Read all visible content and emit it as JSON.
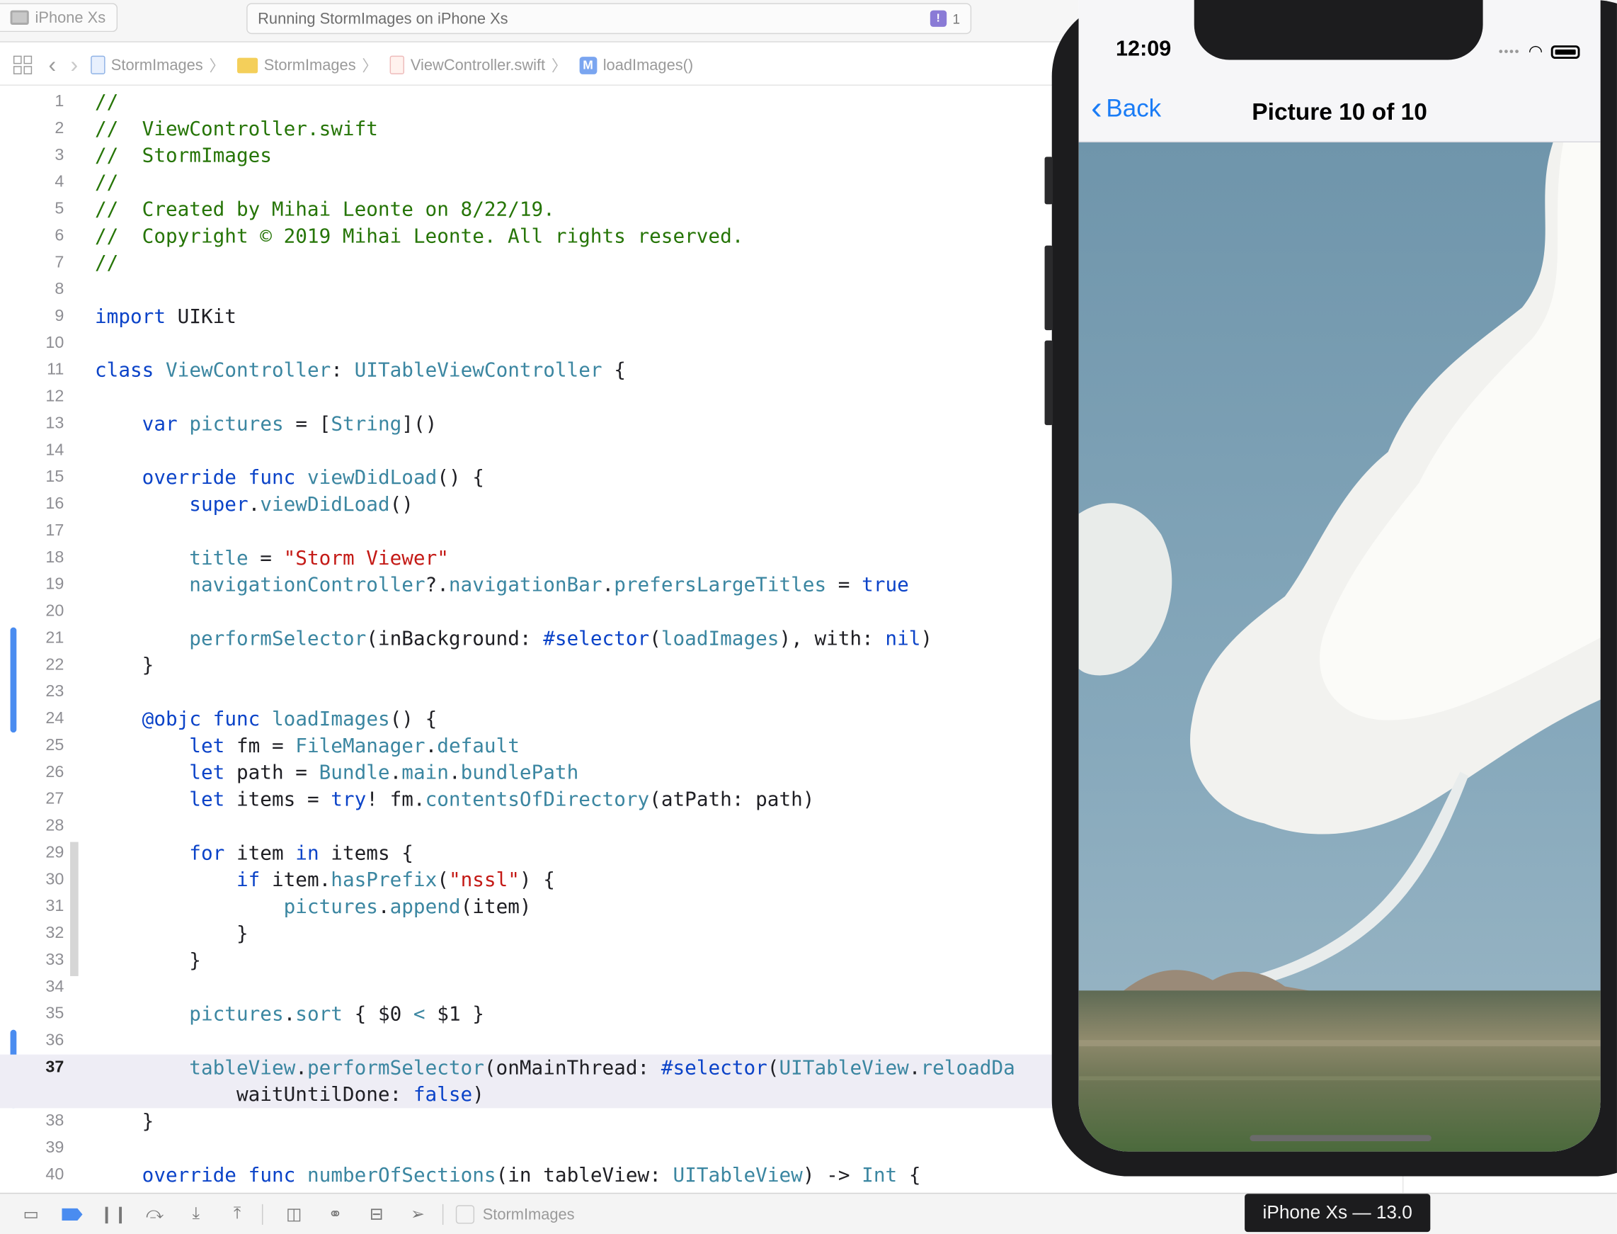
{
  "toolbar": {
    "device": "iPhone Xs",
    "activity": "Running StormImages on iPhone Xs",
    "issue_count": "1",
    "issue_icon": "!"
  },
  "jumpbar": {
    "project": "StormImages",
    "group": "StormImages",
    "file": "ViewController.swift",
    "method_icon_letter": "M",
    "symbol": "loadImages()"
  },
  "editor": {
    "current_line": "37",
    "lines": [
      {
        "n": "1",
        "t": [
          [
            "//",
            "comment"
          ]
        ]
      },
      {
        "n": "2",
        "t": [
          [
            "//  ViewController.swift",
            "comment"
          ]
        ]
      },
      {
        "n": "3",
        "t": [
          [
            "//  StormImages",
            "comment"
          ]
        ]
      },
      {
        "n": "4",
        "t": [
          [
            "//",
            "comment"
          ]
        ]
      },
      {
        "n": "5",
        "t": [
          [
            "//  Created by Mihai Leonte on 8/22/19.",
            "comment"
          ]
        ]
      },
      {
        "n": "6",
        "t": [
          [
            "//  Copyright © 2019 Mihai Leonte. All rights reserved.",
            "comment"
          ]
        ]
      },
      {
        "n": "7",
        "t": [
          [
            "//",
            "comment"
          ]
        ]
      },
      {
        "n": "8",
        "t": []
      },
      {
        "n": "9",
        "t": [
          [
            "import",
            "kw"
          ],
          [
            " UIKit",
            "plain"
          ]
        ]
      },
      {
        "n": "10",
        "t": []
      },
      {
        "n": "11",
        "t": [
          [
            "class",
            "kw"
          ],
          [
            " ",
            "plain"
          ],
          [
            "ViewController",
            "type"
          ],
          [
            ": ",
            "plain"
          ],
          [
            "UITableViewController",
            "type"
          ],
          [
            " {",
            "plain"
          ]
        ]
      },
      {
        "n": "12",
        "t": []
      },
      {
        "n": "13",
        "t": [
          [
            "    ",
            "plain"
          ],
          [
            "var",
            "kw"
          ],
          [
            " ",
            "plain"
          ],
          [
            "pictures",
            "fn"
          ],
          [
            " = [",
            "plain"
          ],
          [
            "String",
            "type"
          ],
          [
            "]()",
            "plain"
          ]
        ]
      },
      {
        "n": "14",
        "t": []
      },
      {
        "n": "15",
        "t": [
          [
            "    ",
            "plain"
          ],
          [
            "override",
            "kw"
          ],
          [
            " ",
            "plain"
          ],
          [
            "func",
            "kw"
          ],
          [
            " ",
            "plain"
          ],
          [
            "viewDidLoad",
            "fn"
          ],
          [
            "() {",
            "plain"
          ]
        ]
      },
      {
        "n": "16",
        "t": [
          [
            "        ",
            "plain"
          ],
          [
            "super",
            "kw"
          ],
          [
            ".",
            "plain"
          ],
          [
            "viewDidLoad",
            "fn"
          ],
          [
            "()",
            "plain"
          ]
        ]
      },
      {
        "n": "17",
        "t": []
      },
      {
        "n": "18",
        "t": [
          [
            "        ",
            "plain"
          ],
          [
            "title",
            "fn"
          ],
          [
            " = ",
            "plain"
          ],
          [
            "\"Storm Viewer\"",
            "str"
          ]
        ]
      },
      {
        "n": "19",
        "t": [
          [
            "        ",
            "plain"
          ],
          [
            "navigationController",
            "fn"
          ],
          [
            "?.",
            "plain"
          ],
          [
            "navigationBar",
            "fn"
          ],
          [
            ".",
            "plain"
          ],
          [
            "prefersLargeTitles",
            "fn"
          ],
          [
            " = ",
            "plain"
          ],
          [
            "true",
            "kw"
          ]
        ]
      },
      {
        "n": "20",
        "t": []
      },
      {
        "n": "21",
        "t": [
          [
            "        ",
            "plain"
          ],
          [
            "performSelector",
            "fn"
          ],
          [
            "(inBackground: ",
            "plain"
          ],
          [
            "#selector",
            "kw"
          ],
          [
            "(",
            "plain"
          ],
          [
            "loadImages",
            "fn"
          ],
          [
            "), with: ",
            "plain"
          ],
          [
            "nil",
            "kw"
          ],
          [
            ")",
            "plain"
          ]
        ]
      },
      {
        "n": "22",
        "t": [
          [
            "    }",
            "plain"
          ]
        ]
      },
      {
        "n": "23",
        "t": []
      },
      {
        "n": "24",
        "t": [
          [
            "    ",
            "plain"
          ],
          [
            "@objc",
            "kw"
          ],
          [
            " ",
            "plain"
          ],
          [
            "func",
            "kw"
          ],
          [
            " ",
            "plain"
          ],
          [
            "loadImages",
            "fn"
          ],
          [
            "() {",
            "plain"
          ]
        ]
      },
      {
        "n": "25",
        "t": [
          [
            "        ",
            "plain"
          ],
          [
            "let",
            "kw"
          ],
          [
            " fm = ",
            "plain"
          ],
          [
            "FileManager",
            "type"
          ],
          [
            ".",
            "plain"
          ],
          [
            "default",
            "fn"
          ]
        ]
      },
      {
        "n": "26",
        "t": [
          [
            "        ",
            "plain"
          ],
          [
            "let",
            "kw"
          ],
          [
            " path = ",
            "plain"
          ],
          [
            "Bundle",
            "type"
          ],
          [
            ".",
            "plain"
          ],
          [
            "main",
            "fn"
          ],
          [
            ".",
            "plain"
          ],
          [
            "bundlePath",
            "fn"
          ]
        ]
      },
      {
        "n": "27",
        "t": [
          [
            "        ",
            "plain"
          ],
          [
            "let",
            "kw"
          ],
          [
            " items = ",
            "plain"
          ],
          [
            "try",
            "kw"
          ],
          [
            "! fm.",
            "plain"
          ],
          [
            "contentsOfDirectory",
            "fn"
          ],
          [
            "(atPath: path)",
            "plain"
          ]
        ]
      },
      {
        "n": "28",
        "t": []
      },
      {
        "n": "29",
        "t": [
          [
            "        ",
            "plain"
          ],
          [
            "for",
            "kw"
          ],
          [
            " item ",
            "plain"
          ],
          [
            "in",
            "kw"
          ],
          [
            " items {",
            "plain"
          ]
        ]
      },
      {
        "n": "30",
        "t": [
          [
            "            ",
            "plain"
          ],
          [
            "if",
            "kw"
          ],
          [
            " item.",
            "plain"
          ],
          [
            "hasPrefix",
            "fn"
          ],
          [
            "(",
            "plain"
          ],
          [
            "\"nssl\"",
            "str"
          ],
          [
            ") {",
            "plain"
          ]
        ]
      },
      {
        "n": "31",
        "t": [
          [
            "                ",
            "plain"
          ],
          [
            "pictures",
            "fn"
          ],
          [
            ".",
            "plain"
          ],
          [
            "append",
            "fn"
          ],
          [
            "(item)",
            "plain"
          ]
        ]
      },
      {
        "n": "32",
        "t": [
          [
            "            }",
            "plain"
          ]
        ]
      },
      {
        "n": "33",
        "t": [
          [
            "        }",
            "plain"
          ]
        ]
      },
      {
        "n": "34",
        "t": []
      },
      {
        "n": "35",
        "t": [
          [
            "        ",
            "plain"
          ],
          [
            "pictures",
            "fn"
          ],
          [
            ".",
            "plain"
          ],
          [
            "sort",
            "fn"
          ],
          [
            " { $0 ",
            "plain"
          ],
          [
            "<",
            "type"
          ],
          [
            " $1 }",
            "plain"
          ]
        ]
      },
      {
        "n": "36",
        "t": []
      },
      {
        "n": "37",
        "t": [
          [
            "        ",
            "plain"
          ],
          [
            "tableView",
            "fn"
          ],
          [
            ".",
            "plain"
          ],
          [
            "performSelector",
            "fn"
          ],
          [
            "(onMainThread: ",
            "plain"
          ],
          [
            "#selector",
            "kw"
          ],
          [
            "(",
            "plain"
          ],
          [
            "UITableView",
            "type"
          ],
          [
            ".",
            "plain"
          ],
          [
            "reloadDa",
            "fn"
          ]
        ],
        "t2": [
          [
            "            waitUntilDone: ",
            "plain"
          ],
          [
            "false",
            "kw"
          ],
          [
            ")",
            "plain"
          ]
        ]
      },
      {
        "n": "38",
        "t": [
          [
            "    }",
            "plain"
          ]
        ]
      },
      {
        "n": "39",
        "t": []
      },
      {
        "n": "40",
        "t": [
          [
            "    ",
            "plain"
          ],
          [
            "override",
            "kw"
          ],
          [
            " ",
            "plain"
          ],
          [
            "func",
            "kw"
          ],
          [
            " ",
            "plain"
          ],
          [
            "numberOfSections",
            "fn"
          ],
          [
            "(in tableView: ",
            "plain"
          ],
          [
            "UITableView",
            "type"
          ],
          [
            ") -> ",
            "plain"
          ],
          [
            "Int",
            "type"
          ],
          [
            " {",
            "plain"
          ]
        ]
      }
    ]
  },
  "bottombar": {
    "target": "StormImages"
  },
  "simulator": {
    "time": "12:09",
    "back_label": "Back",
    "nav_title": "Picture 10 of 10",
    "device_label": "iPhone Xs — 13.0"
  }
}
